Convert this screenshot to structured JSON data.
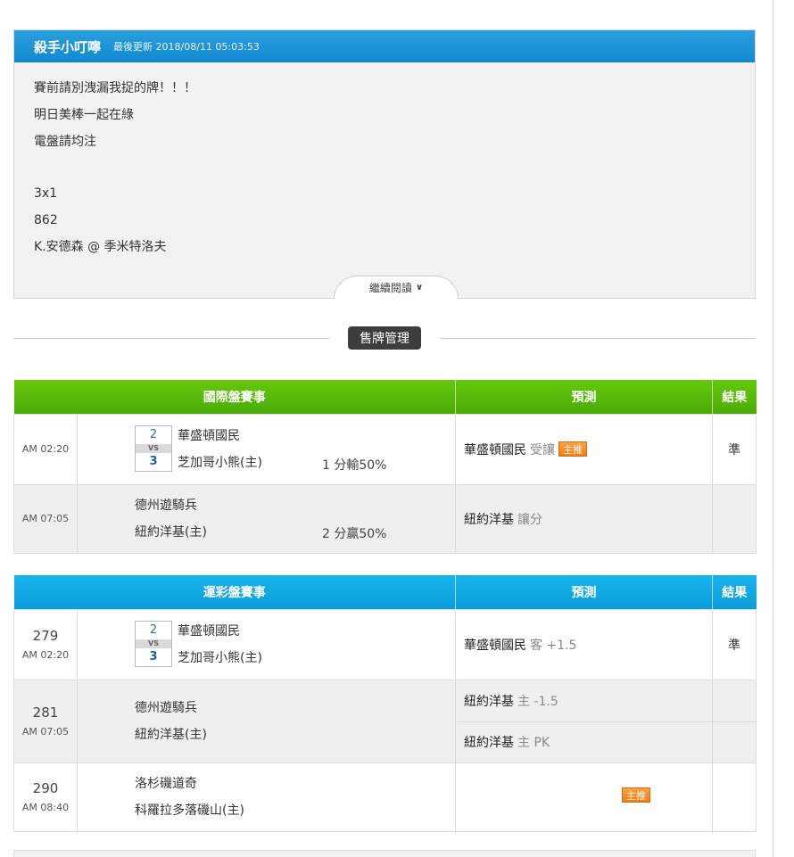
{
  "post": {
    "author": "殺手小叮嚀",
    "updated": "最後更新 2018/08/11 05:03:53",
    "lines": [
      "賽前請別洩漏我捉的牌！！！",
      "明日美棒一起在綠",
      "電盤請均注",
      "",
      "3x1",
      "862",
      "K.安德森 @ 季米特洛夫"
    ],
    "read_more": "繼續閱讀"
  },
  "divider": {
    "label": "售牌管理"
  },
  "intl_table": {
    "headers": [
      "國際盤賽事",
      "預測",
      "結果"
    ],
    "rows": [
      {
        "time": "AM 02:20",
        "score_away": "2",
        "vs": "VS",
        "score_home": "3",
        "away": "華盛頓國民",
        "home": "芝加哥小熊(主)",
        "handicap": "1 分輸50%",
        "pred_team": "華盛頓國民",
        "pred_tip": "受讓",
        "push": "主推",
        "result": "準"
      },
      {
        "time": "AM 07:05",
        "away": "德州遊騎兵",
        "home": "紐約洋基(主)",
        "handicap": "2 分贏50%",
        "pred_team": "紐約洋基",
        "pred_tip": "讓分",
        "result": ""
      }
    ]
  },
  "sports_table": {
    "headers": [
      "運彩盤賽事",
      "預測",
      "結果"
    ],
    "rows": [
      {
        "num": "279",
        "time": "AM 02:20",
        "score_away": "2",
        "vs": "VS",
        "score_home": "3",
        "away": "華盛頓國民",
        "home": "芝加哥小熊(主)",
        "pred_team": "華盛頓國民",
        "pred_tip": "客 +1.5",
        "result": "準"
      },
      {
        "num": "281",
        "time": "AM 07:05",
        "away": "德州遊騎兵",
        "home": "紐約洋基(主)",
        "pred1_team": "紐約洋基",
        "pred1_tip": "主 -1.5",
        "pred2_team": "紐約洋基",
        "pred2_tip": "主 PK",
        "result": ""
      },
      {
        "num": "290",
        "time": "AM 08:40",
        "away": "洛杉磯道奇",
        "home": "科羅拉多落磯山(主)",
        "push": "主推",
        "result": ""
      }
    ]
  }
}
